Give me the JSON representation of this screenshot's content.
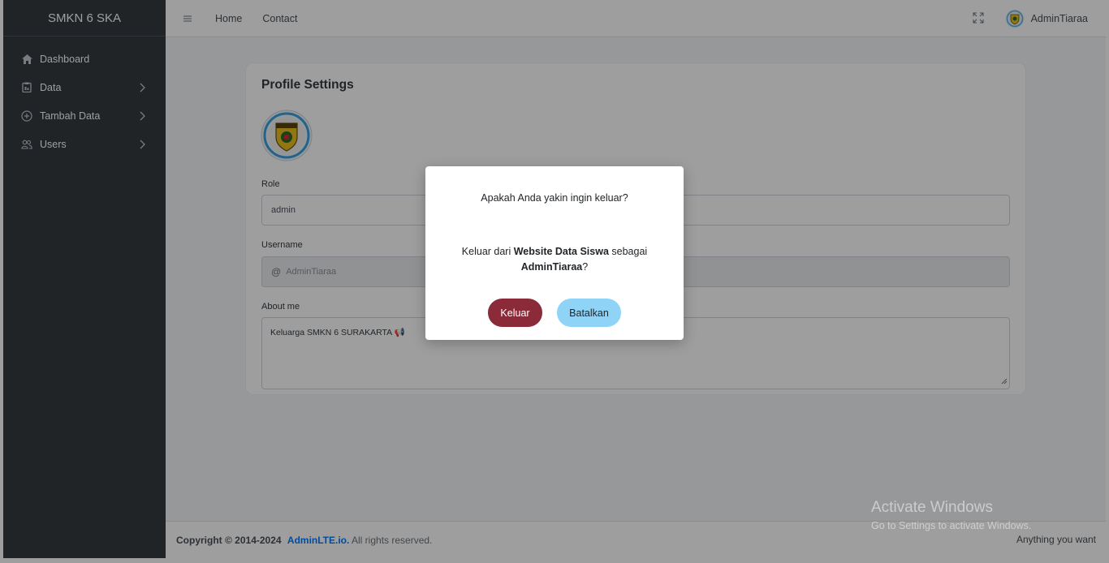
{
  "sidebar": {
    "brand": "SMKN 6 SKA",
    "items": [
      {
        "label": "Dashboard",
        "icon": "house-icon",
        "has_children": false
      },
      {
        "label": "Data",
        "icon": "clipboard-icon",
        "has_children": true
      },
      {
        "label": "Tambah Data",
        "icon": "plus-circle-icon",
        "has_children": true
      },
      {
        "label": "Users",
        "icon": "users-icon",
        "has_children": true
      }
    ]
  },
  "header": {
    "links": [
      "Home",
      "Contact"
    ],
    "user_name": "AdminTiaraa"
  },
  "profile": {
    "title": "Profile Settings",
    "role_label": "Role",
    "role_value": "admin",
    "username_label": "Username",
    "username_placeholder": "AdminTiaraa",
    "about_label": "About me",
    "about_value": "Keluarga SMKN 6 SURAKARTA 📢"
  },
  "modal": {
    "question": "Apakah Anda yakin ingin keluar?",
    "msg_prefix": "Keluar dari ",
    "msg_site": "Website Data Siswa",
    "msg_middle": " sebagai ",
    "msg_user": "AdminTiaraa",
    "msg_suffix": "?",
    "exit_label": "Keluar",
    "cancel_label": "Batalkan",
    "exit_color": "#8b2a38",
    "cancel_color": "#8fd3f7"
  },
  "footer": {
    "copyright": "Copyright © 2014-2024",
    "link": "AdminLTE.io.",
    "rights": "All rights reserved.",
    "right_text": "Anything you want"
  },
  "watermark": {
    "line1": "Activate Windows",
    "line2": "Go to Settings to activate Windows."
  }
}
